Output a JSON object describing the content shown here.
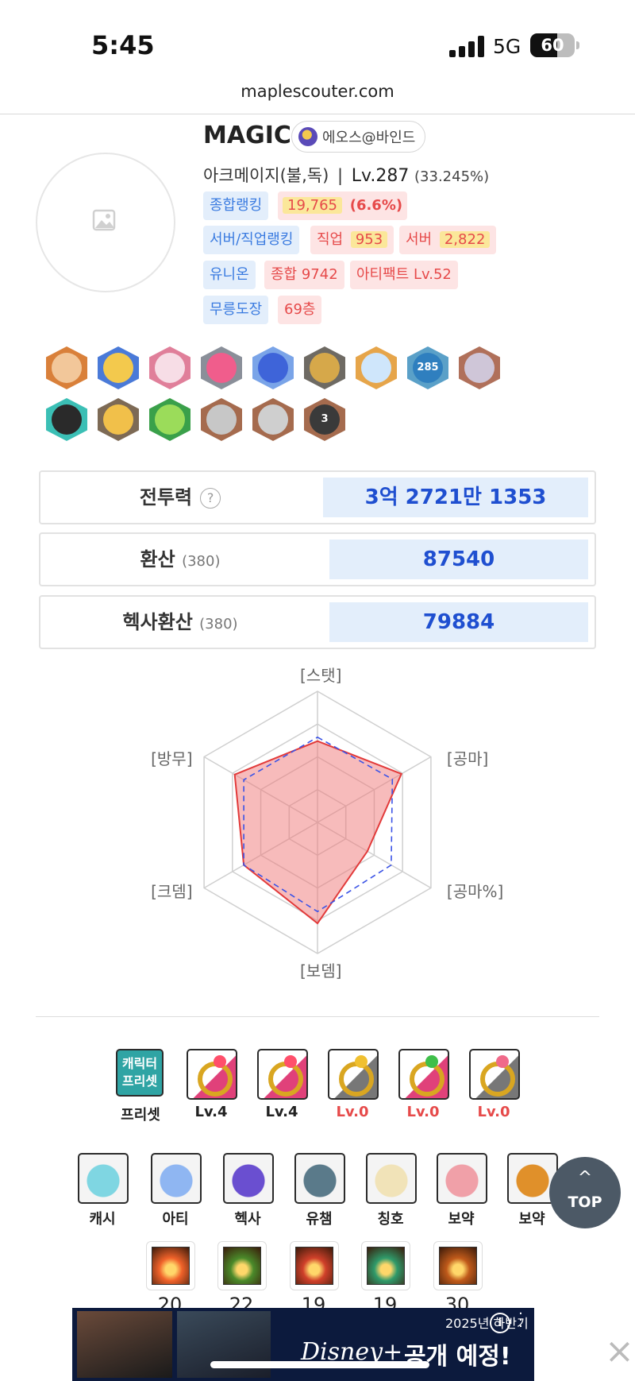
{
  "status_bar": {
    "time": "5:45",
    "network": "5G",
    "battery": "60",
    "battery_level": 0.6
  },
  "browser": {
    "url": "maplescouter.com"
  },
  "profile": {
    "name": "MAGIC",
    "world": "에오스@바인드",
    "job": "아크메이지(불,독)",
    "separator": "|",
    "level": "Lv.287",
    "exp_pct": "(33.245%)"
  },
  "tags": {
    "overall_rank_label": "종합랭킹",
    "overall_rank_value": "19,765",
    "overall_rank_pct": "(6.6%)",
    "server_job_rank_label": "서버/직업랭킹",
    "job_label": "직업",
    "job_value": "953",
    "server_label": "서버",
    "server_value": "2,822",
    "union_label": "유니온",
    "union_total": "종합 9742",
    "artifact": "아티팩트 Lv.52",
    "dojo_label": "무릉도장",
    "dojo_value": "69층"
  },
  "badges": [
    {
      "name": "bronze-medal-badge",
      "color": "#d9803a",
      "inner": "#f2c79a"
    },
    {
      "name": "trophy-badge",
      "color": "#4a7ad8",
      "inner": "#f3c94d"
    },
    {
      "name": "target-badge",
      "color": "#e07f9a",
      "inner": "#f7dde6"
    },
    {
      "name": "ring-gem-badge",
      "color": "#8a8f99",
      "inner": "#f05d8c"
    },
    {
      "name": "blue-flame-badge",
      "color": "#7aa4e8",
      "inner": "#3e64d9"
    },
    {
      "name": "knight-badge",
      "color": "#6e6a63",
      "inner": "#d6a84a"
    },
    {
      "name": "diamond-badge",
      "color": "#e6a54a",
      "inner": "#cfe6fb"
    },
    {
      "name": "level-285-badge",
      "color": "#5aa0c8",
      "inner": "#2f7fbf",
      "label": "285"
    },
    {
      "name": "character-portrait-badge",
      "color": "#b0705a",
      "inner": "#cfc6d8"
    },
    {
      "name": "star-hat-badge",
      "color": "#3bbfb5",
      "inner": "#2a2a2a"
    },
    {
      "name": "gold-star-badge",
      "color": "#7d6a55",
      "inner": "#f1c04a"
    },
    {
      "name": "green-monster-badge",
      "color": "#3aa04a",
      "inner": "#9bdc5a"
    },
    {
      "name": "crossed-swords-badge",
      "color": "#a56b4e",
      "inner": "#c7c7c7"
    },
    {
      "name": "armor-badge",
      "color": "#a56b4e",
      "inner": "#cfcfcf"
    },
    {
      "name": "wizard-hat-badge",
      "color": "#a56b4e",
      "inner": "#3a3a3a",
      "label": "3"
    }
  ],
  "stats": {
    "combat_power_label": "전투력",
    "help": "?",
    "combat_power_value": "3억 2721만 1353",
    "conversion_label": "환산",
    "conversion_sub": "(380)",
    "conversion_value": "87540",
    "hexa_conversion_label": "헥사환산",
    "hexa_conversion_sub": "(380)",
    "hexa_conversion_value": "79884"
  },
  "chart_data": {
    "type": "radar",
    "axes": [
      "[스탯]",
      "[공마]",
      "[공마%]",
      "[보뎀]",
      "[크뎀]",
      "[방무]"
    ],
    "max": 1.0,
    "series": [
      {
        "values": [
          0.62,
          0.74,
          0.44,
          0.77,
          0.65,
          0.73
        ],
        "color": "#e23a3a",
        "style": "solid-fill"
      },
      {
        "values": [
          0.65,
          0.66,
          0.65,
          0.68,
          0.65,
          0.65
        ],
        "color": "#3b53e6",
        "style": "dashed"
      }
    ],
    "grid_levels": 4
  },
  "equipment_row": [
    {
      "name": "character-preset-button",
      "label": "프리셋",
      "icon_text": "캐릭터\n프리셋",
      "color": "#2fa4a4"
    },
    {
      "name": "ring-slot-1",
      "label": "Lv.4",
      "color": "#e0417a",
      "gem": "#ff4f6b",
      "red": false
    },
    {
      "name": "ring-slot-2",
      "label": "Lv.4",
      "color": "#e0417a",
      "gem": "#ff4f6b",
      "red": false
    },
    {
      "name": "ring-slot-3",
      "label": "Lv.0",
      "color": "#777777",
      "gem": "#f0c030",
      "red": true
    },
    {
      "name": "ring-slot-4",
      "label": "Lv.0",
      "color": "#e0417a",
      "gem": "#3fbf4a",
      "red": true
    },
    {
      "name": "ring-slot-5",
      "label": "Lv.0",
      "color": "#777777",
      "gem": "#f06a8a",
      "red": true
    }
  ],
  "menu_row": [
    {
      "name": "cash-item-button",
      "label": "캐시",
      "color": "#7fd6e2"
    },
    {
      "name": "artifact-button",
      "label": "아티",
      "color": "#8fb6f2"
    },
    {
      "name": "hexa-button",
      "label": "헥사",
      "color": "#6a4fd0"
    },
    {
      "name": "legion-champion-button",
      "label": "유챔",
      "color": "#5a7a8a"
    },
    {
      "name": "title-button",
      "label": "칭호",
      "color": "#f1e3b8"
    },
    {
      "name": "potion-button-1",
      "label": "보약",
      "color": "#f0a0a8"
    },
    {
      "name": "potion-button-2",
      "label": "보약",
      "color": "#e0902a"
    }
  ],
  "skills": [
    {
      "name": "skill-fire-1",
      "value": "20",
      "color": "#f0622a"
    },
    {
      "name": "skill-poison",
      "value": "22",
      "color": "#4a8a2a"
    },
    {
      "name": "skill-fire-2",
      "value": "19",
      "color": "#d0402a"
    },
    {
      "name": "skill-green",
      "value": "19",
      "color": "#2f9a6a"
    },
    {
      "name": "skill-fire-3",
      "value": "30",
      "color": "#c05a1a"
    }
  ],
  "top_button": {
    "arrow": "^",
    "label": "TOP"
  },
  "ad": {
    "headline": "2025년 하반기",
    "brand": "Disney+",
    "tagline": "공개 예정!",
    "info": "i",
    "close": "×"
  }
}
